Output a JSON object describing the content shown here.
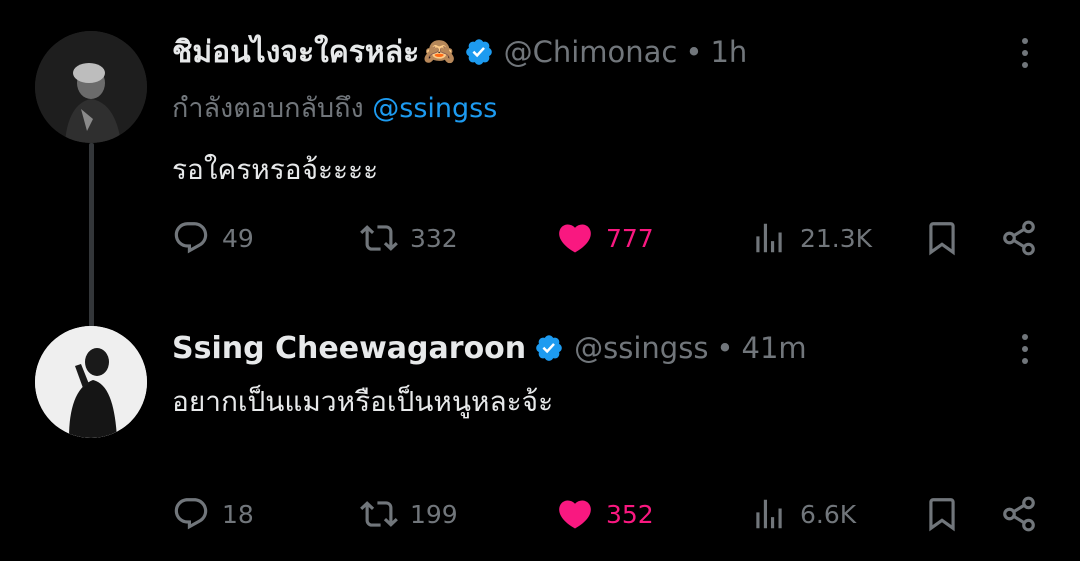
{
  "tweets": [
    {
      "display_name": "ชิม่อนไงจะใครหล่ะ",
      "emoji": "🙈",
      "handle": "@Chimonac",
      "separator": "•",
      "time": "1h",
      "replying_prefix": "กำลังตอบกลับถึง",
      "replying_mention": "@ssingss",
      "text": "รอใครหรอจ้ะะะะ",
      "stats": {
        "replies": "49",
        "retweets": "332",
        "likes": "777",
        "views": "21.3K"
      },
      "liked": true,
      "avatar_icon": "profile-photo-dark"
    },
    {
      "display_name": "Ssing Cheewagaroon",
      "handle": "@ssingss",
      "separator": "•",
      "time": "41m",
      "text": "อยากเป็นแมวหรือเป็นหนูหละจ้ะ",
      "stats": {
        "replies": "18",
        "retweets": "199",
        "likes": "352",
        "views": "6.6K"
      },
      "liked": true,
      "avatar_icon": "profile-photo-light"
    }
  ],
  "colors": {
    "background": "#000000",
    "text": "#e7e9ea",
    "muted": "#71767b",
    "link": "#1d9bf0",
    "like": "#f91880",
    "verified": "#1d9bf0"
  },
  "icons": [
    "verified-badge-icon",
    "more-icon",
    "reply-icon",
    "retweet-icon",
    "heart-icon",
    "views-icon",
    "bookmark-icon",
    "share-icon"
  ]
}
